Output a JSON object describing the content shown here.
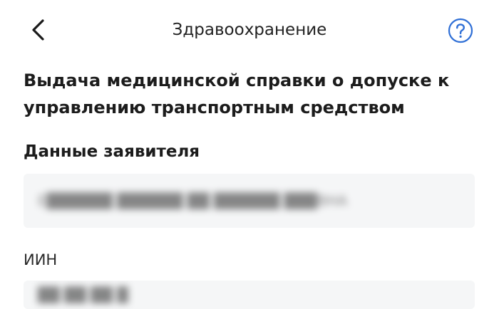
{
  "header": {
    "title": "Здравоохранение",
    "back_icon": "chevron-left-icon",
    "help_icon": "question-circle-icon",
    "accent_color": "#2f6fd6"
  },
  "page": {
    "title": "Выдача медицинской справки о допуске к управлению транспортным средством"
  },
  "applicant_section": {
    "title": "Данные заявителя",
    "fields": [
      {
        "label": "",
        "value": "Е██████ ██████ ██ ██████ ███ВНА",
        "redacted": true
      },
      {
        "label": "ИИН",
        "value": "██ ██ ██ █",
        "redacted": true
      }
    ]
  }
}
